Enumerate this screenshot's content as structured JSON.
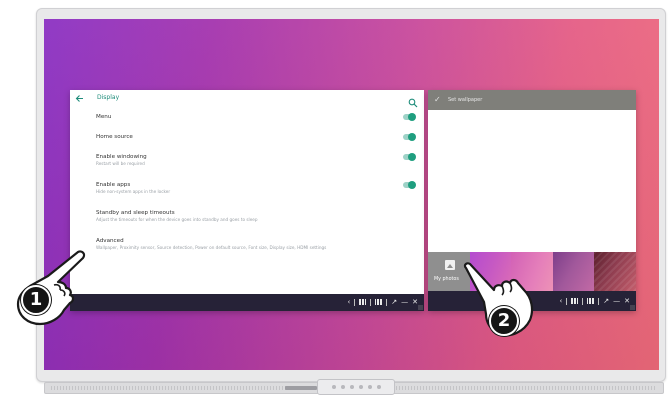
{
  "settings_window": {
    "header_title": "Display",
    "rows": [
      {
        "title": "Menu",
        "subtitle": "",
        "toggle": true
      },
      {
        "title": "Home source",
        "subtitle": "",
        "toggle": true
      },
      {
        "title": "Enable windowing",
        "subtitle": "Restart will be required",
        "toggle": true
      },
      {
        "title": "Enable apps",
        "subtitle": "Hide non-system apps in the locker",
        "toggle": true
      },
      {
        "title": "Standby and sleep timeouts",
        "subtitle": "Adjust the timeouts for when the device goes into standby and goes to sleep",
        "toggle": false
      },
      {
        "title": "Advanced",
        "subtitle": "Wallpaper, Proximity sensor, Source detection, Power on default source, Font size, Display size, HDMI settings",
        "toggle": false
      }
    ]
  },
  "wallpaper_window": {
    "header_title": "Set wallpaper",
    "my_photos_label": "My photos"
  },
  "callouts": {
    "step1": "1",
    "step2": "2"
  },
  "colors": {
    "accent": "#1e8c7a",
    "toggle_on": "#1f9e7f",
    "window_bar": "#262237",
    "wallpaper_header": "#7f7f7a"
  },
  "icons": [
    "back-arrow-icon",
    "search-icon",
    "check-icon",
    "photo-icon",
    "chevron-left-icon",
    "tile-split-icon",
    "tile-quad-icon",
    "expand-icon",
    "minimize-icon",
    "close-icon",
    "pointing-hand-icon"
  ]
}
